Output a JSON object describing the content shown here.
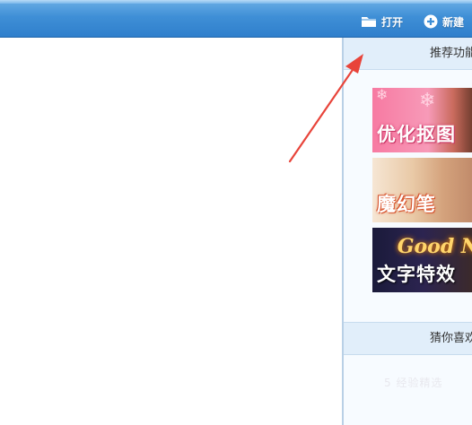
{
  "toolbar": {
    "open_label": "打开",
    "new_label": "新建",
    "open_icon": "folder-icon",
    "new_icon": "plus-circle-icon"
  },
  "side_panel": {
    "recommended_title": "推荐功能",
    "guess_title": "猜你喜欢",
    "features": [
      {
        "label": "优化抠图"
      },
      {
        "label": "魔幻笔"
      },
      {
        "label": "文字特效",
        "script_text": "Good N"
      }
    ]
  },
  "watermark": "5 经验精选",
  "colors": {
    "toolbar_blue": "#3f8fd6",
    "panel_header": "#e1eefa",
    "arrow_red": "#e8443a"
  }
}
